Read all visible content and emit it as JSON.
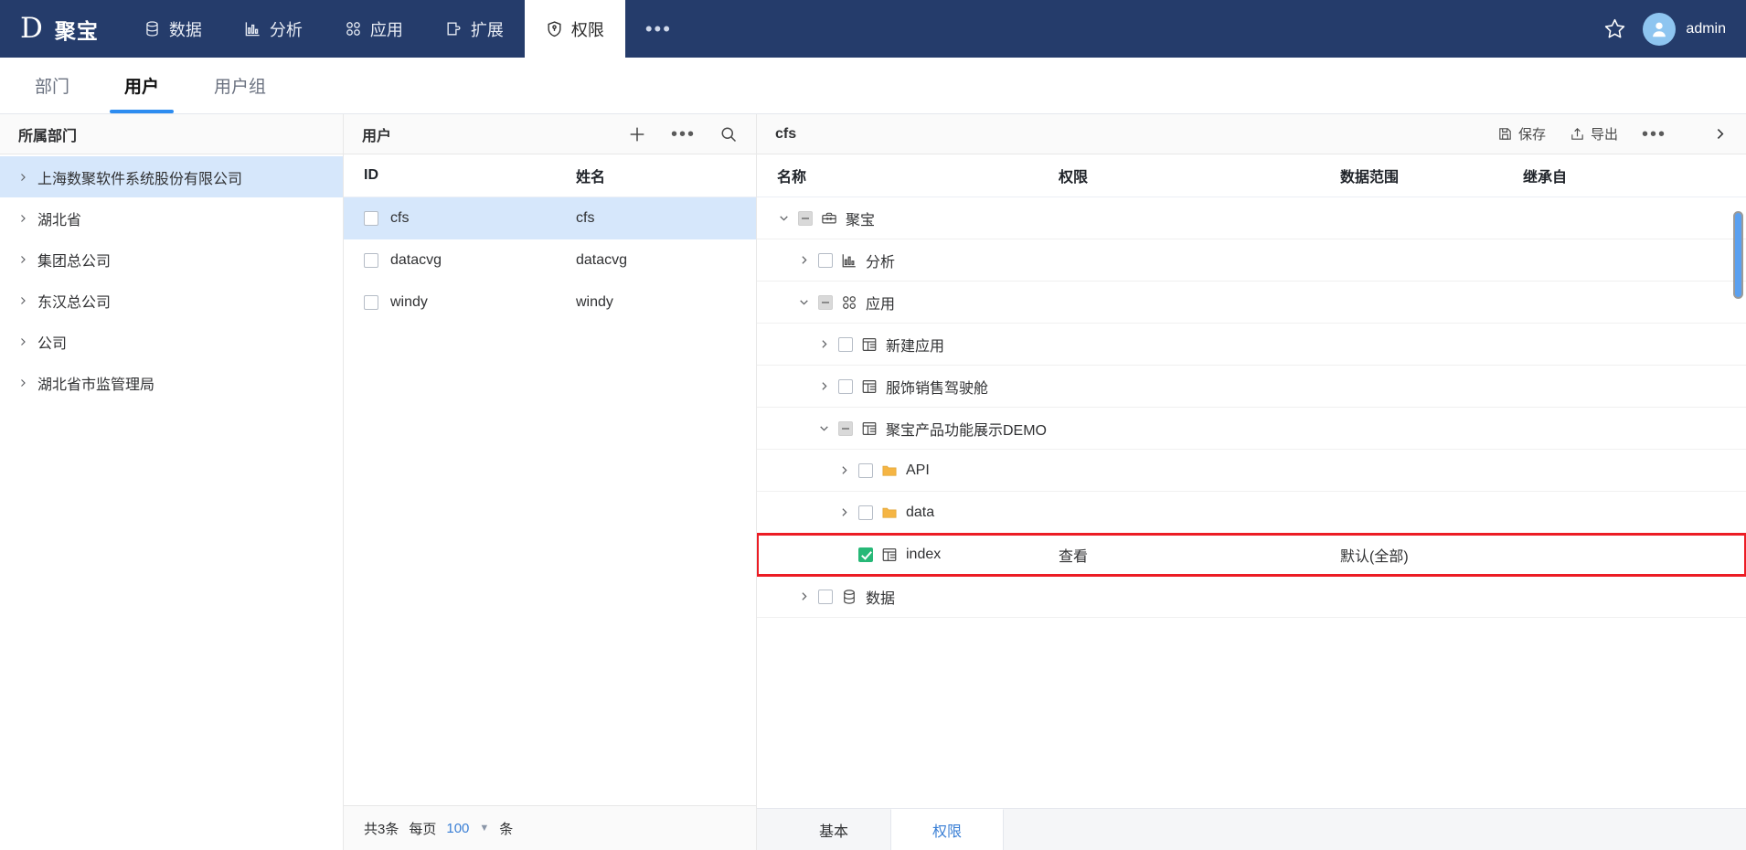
{
  "topbar": {
    "brand_mark": "D",
    "brand_name": "聚宝",
    "nav": [
      {
        "label": "数据",
        "icon": "database-icon",
        "active": false
      },
      {
        "label": "分析",
        "icon": "chart-bar-icon",
        "active": false
      },
      {
        "label": "应用",
        "icon": "apps-grid-icon",
        "active": false
      },
      {
        "label": "扩展",
        "icon": "extension-icon",
        "active": false
      },
      {
        "label": "权限",
        "icon": "shield-key-icon",
        "active": true
      }
    ],
    "more_label": "•••",
    "star_icon": "star-outline-icon",
    "user_name": "admin",
    "avatar_icon": "user-avatar-icon"
  },
  "subtabs": [
    {
      "label": "部门",
      "active": false
    },
    {
      "label": "用户",
      "active": true
    },
    {
      "label": "用户组",
      "active": false
    }
  ],
  "dept_panel": {
    "title": "所属部门",
    "items": [
      {
        "label": "上海数聚软件系统股份有限公司",
        "selected": true
      },
      {
        "label": "湖北省",
        "selected": false
      },
      {
        "label": "集团总公司",
        "selected": false
      },
      {
        "label": "东汉总公司",
        "selected": false
      },
      {
        "label": "公司",
        "selected": false
      },
      {
        "label": "湖北省市监管理局",
        "selected": false
      }
    ]
  },
  "user_panel": {
    "title": "用户",
    "actions": {
      "add": "+",
      "more": "•••",
      "search": "search-icon"
    },
    "columns": [
      "ID",
      "姓名"
    ],
    "rows": [
      {
        "id": "cfs",
        "name": "cfs",
        "checked": false,
        "selected": true
      },
      {
        "id": "datacvg",
        "name": "datacvg",
        "checked": false,
        "selected": false
      },
      {
        "id": "windy",
        "name": "windy",
        "checked": false,
        "selected": false
      }
    ],
    "pager": {
      "total_text": "共3条",
      "per_page_label": "每页",
      "per_page_value": "100",
      "unit": "条"
    }
  },
  "perm_panel": {
    "title": "cfs",
    "actions": {
      "save": "保存",
      "export": "导出",
      "more": "•••",
      "expand": "chevron-right-icon"
    },
    "columns": {
      "name": "名称",
      "permission": "权限",
      "scope": "数据范围",
      "inherit": "继承自"
    },
    "tree": [
      {
        "indent": 0,
        "expander": "down",
        "check": "indeterminate",
        "icon": "toolbox-icon",
        "name": "聚宝",
        "permission": "",
        "scope": "",
        "inherit": "",
        "highlight": false
      },
      {
        "indent": 1,
        "expander": "right",
        "check": "unchecked",
        "icon": "chart-bar-icon",
        "name": "分析",
        "permission": "",
        "scope": "",
        "inherit": "",
        "highlight": false
      },
      {
        "indent": 1,
        "expander": "down",
        "check": "indeterminate",
        "icon": "apps-grid-icon",
        "name": "应用",
        "permission": "",
        "scope": "",
        "inherit": "",
        "highlight": false
      },
      {
        "indent": 2,
        "expander": "right",
        "check": "unchecked",
        "icon": "dashboard-icon",
        "name": "新建应用",
        "permission": "",
        "scope": "",
        "inherit": "",
        "highlight": false
      },
      {
        "indent": 2,
        "expander": "right",
        "check": "unchecked",
        "icon": "dashboard-icon",
        "name": "服饰销售驾驶舱",
        "permission": "",
        "scope": "",
        "inherit": "",
        "highlight": false
      },
      {
        "indent": 2,
        "expander": "down",
        "check": "indeterminate",
        "icon": "dashboard-icon",
        "name": "聚宝产品功能展示DEMO",
        "permission": "",
        "scope": "",
        "inherit": "",
        "highlight": false
      },
      {
        "indent": 3,
        "expander": "right",
        "check": "unchecked",
        "icon": "folder-icon",
        "name": "API",
        "permission": "",
        "scope": "",
        "inherit": "",
        "highlight": false
      },
      {
        "indent": 3,
        "expander": "right",
        "check": "unchecked",
        "icon": "folder-icon",
        "name": "data",
        "permission": "",
        "scope": "",
        "inherit": "",
        "highlight": false
      },
      {
        "indent": 3,
        "expander": "none",
        "check": "checked",
        "icon": "dashboard-icon",
        "name": "index",
        "permission": "查看",
        "scope": "默认(全部)",
        "inherit": "",
        "highlight": true
      },
      {
        "indent": 1,
        "expander": "right",
        "check": "unchecked",
        "icon": "database-icon",
        "name": "数据",
        "permission": "",
        "scope": "",
        "inherit": "",
        "highlight": false
      }
    ],
    "bottom_tabs": [
      {
        "label": "基本",
        "active": false
      },
      {
        "label": "权限",
        "active": true
      }
    ]
  },
  "colors": {
    "topbar_bg": "#253c6b",
    "accent_blue": "#2d8cf0",
    "selection_blue": "#d6e7fb",
    "highlight_red": "#ec1c24",
    "check_green": "#27b877",
    "folder_yellow": "#f5b544"
  }
}
